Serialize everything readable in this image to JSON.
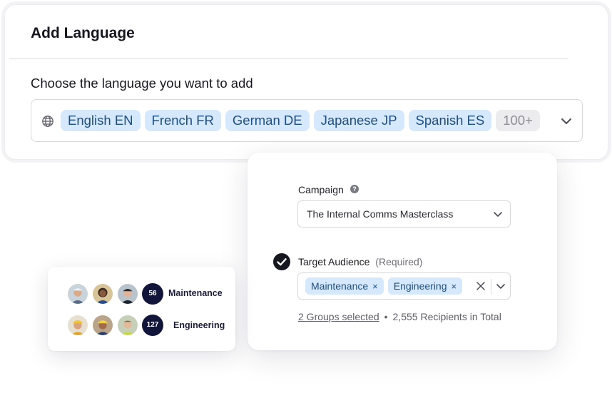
{
  "add_language": {
    "title": "Add Language",
    "subtitle": "Choose the language you want to add",
    "languages": [
      "English EN",
      "French FR",
      "German DE",
      "Japanese JP",
      "Spanish ES"
    ],
    "more_label": "100+",
    "icons": {
      "leading": "globe-icon",
      "trailing": "chevron-down-icon"
    }
  },
  "campaign": {
    "label": "Campaign",
    "help_icon_glyph": "?",
    "selected_value": "The Internal Comms Masterclass"
  },
  "target_audience": {
    "label": "Target Audience",
    "required_label": "(Required)",
    "chips": [
      {
        "label": "Maintenance",
        "remove_glyph": "×"
      },
      {
        "label": "Engineering",
        "remove_glyph": "×"
      }
    ],
    "summary_link": "2 Groups selected",
    "summary_separator": "•",
    "summary_text": "2,555 Recipients in Total",
    "status_icon": "check-circle-icon"
  },
  "groups": [
    {
      "name": "Maintenance",
      "count": "56"
    },
    {
      "name": "Engineering",
      "count": "127"
    }
  ],
  "colors": {
    "chip_bg": "#d6e8fb",
    "chip_text": "#1d4f86",
    "badge_bg": "#12153a"
  }
}
